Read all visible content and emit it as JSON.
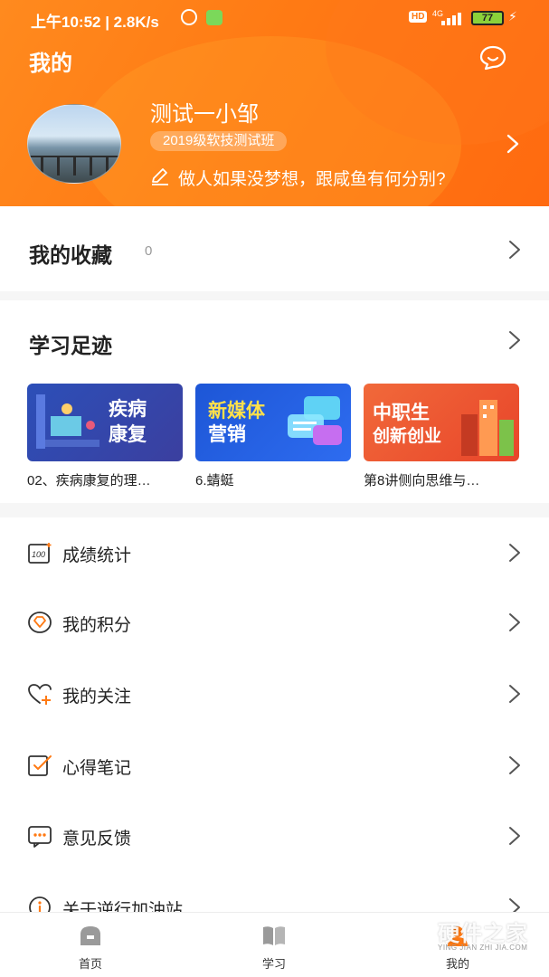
{
  "status_bar": {
    "time_speed": "上午10:52 | 2.8K/s",
    "network": "4G",
    "hd": "HD",
    "battery": "77"
  },
  "header": {
    "title": "我的",
    "username": "测试一小邹",
    "class_tag": "2019级软技测试班",
    "motto": "做人如果没梦想，跟咸鱼有何分别?"
  },
  "favorites": {
    "label": "我的收藏",
    "count": "0"
  },
  "footprint": {
    "label": "学习足迹",
    "courses": [
      {
        "thumb_text": [
          "疾病",
          "康复"
        ],
        "caption": "02、疾病康复的理…"
      },
      {
        "thumb_text": [
          "新媒体",
          "营销"
        ],
        "caption": "6.蜻蜓"
      },
      {
        "thumb_text": [
          "中职生",
          "创新创业"
        ],
        "caption": "第8讲侧向思维与…"
      }
    ]
  },
  "menu": {
    "items": [
      {
        "label": "成绩统计",
        "icon": "score-icon"
      },
      {
        "label": "我的积分",
        "icon": "points-icon"
      },
      {
        "label": "我的关注",
        "icon": "follow-icon"
      },
      {
        "label": "心得笔记",
        "icon": "notes-icon"
      },
      {
        "label": "意见反馈",
        "icon": "feedback-icon"
      },
      {
        "label": "关于逆行加油站",
        "icon": "info-icon"
      }
    ]
  },
  "tabbar": {
    "items": [
      {
        "label": "首页",
        "icon": "home-icon"
      },
      {
        "label": "学习",
        "icon": "book-icon"
      },
      {
        "label": "我的",
        "icon": "profile-icon"
      }
    ]
  },
  "watermark": {
    "title": "硬件之家",
    "subtitle": "YING JIAN ZHI JIA.COM"
  },
  "colors": {
    "accent": "#ff7a14",
    "text": "#222222",
    "muted": "#999999"
  }
}
